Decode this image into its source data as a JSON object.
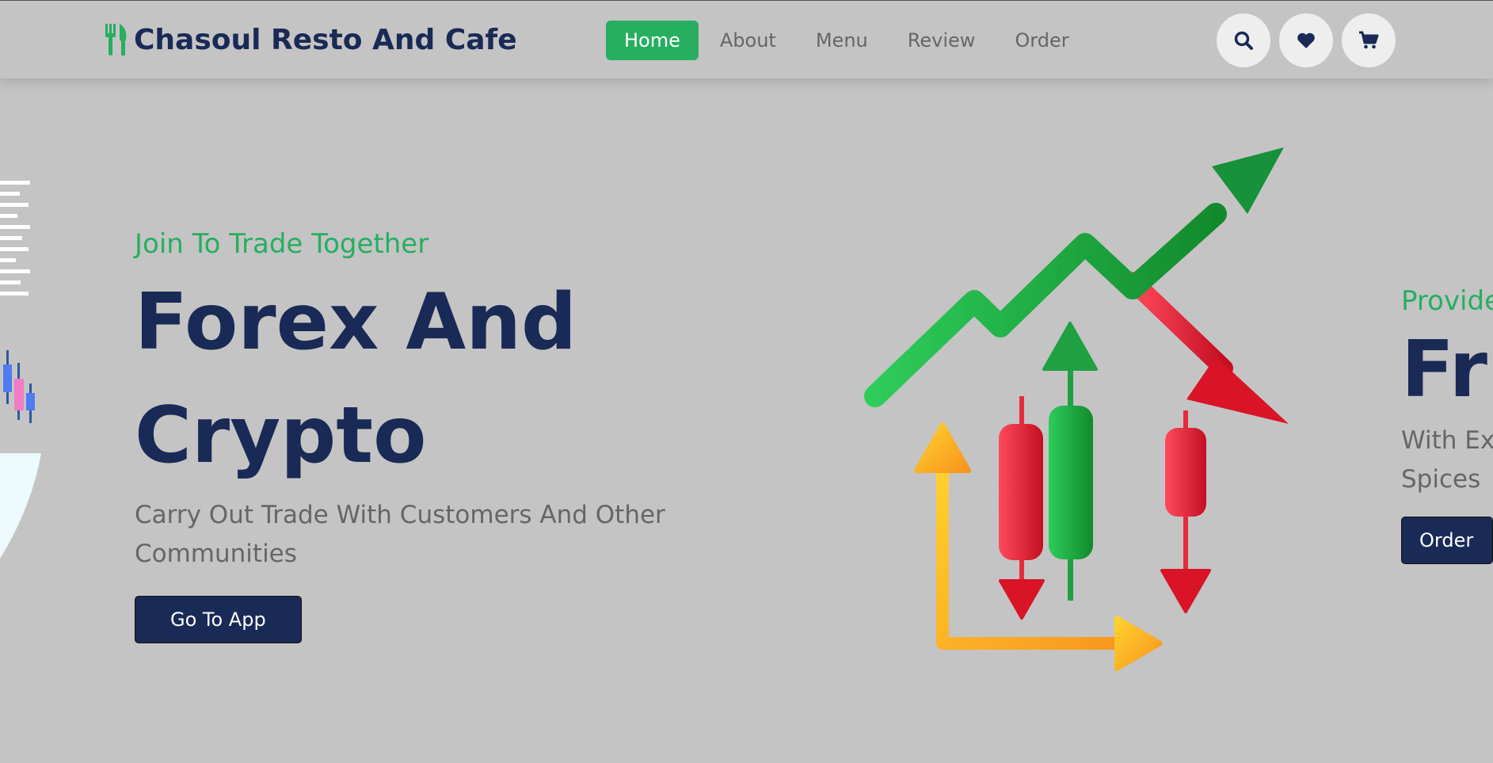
{
  "header": {
    "logo_text": "Chasoul Resto And Cafe",
    "logo_icon": "utensils-icon",
    "nav": [
      {
        "label": "Home",
        "active": true
      },
      {
        "label": "About",
        "active": false
      },
      {
        "label": "Menu",
        "active": false
      },
      {
        "label": "Review",
        "active": false
      },
      {
        "label": "Order",
        "active": false
      }
    ],
    "icons": [
      "search-icon",
      "heart-icon",
      "cart-icon"
    ]
  },
  "slide_main": {
    "subtitle": "Join To Trade Together",
    "title_line1": "Forex And",
    "title_line2": "Crypto",
    "description": "Carry Out Trade With Customers And Other Communities",
    "button": "Go To App"
  },
  "slide_next": {
    "subtitle": "Provide",
    "title": "Fri",
    "description_line1": "With Ex",
    "description_line2": "Spices",
    "button": "Order"
  },
  "colors": {
    "accent_green": "#27ae60",
    "navy": "#192a56",
    "background": "#c4c4c4",
    "text_gray": "#666666"
  }
}
